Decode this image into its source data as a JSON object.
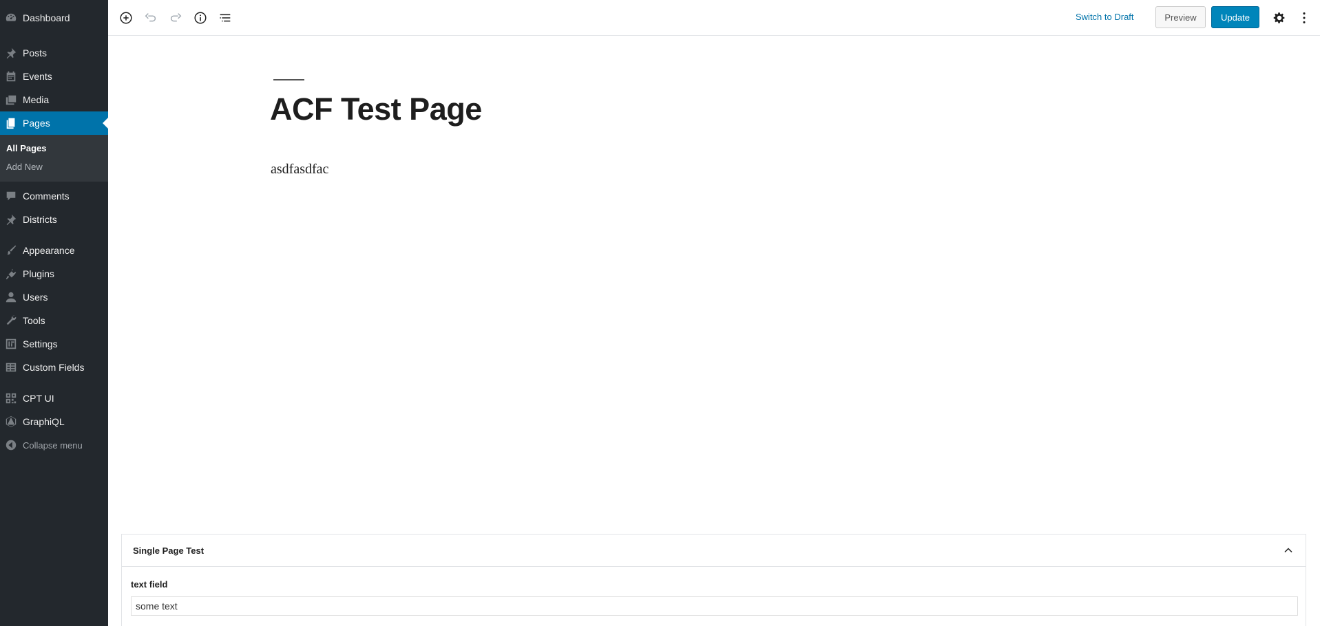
{
  "sidebar": {
    "items": [
      {
        "label": "Dashboard",
        "icon": "dashboard-icon"
      },
      {
        "label": "Posts",
        "icon": "pin-icon"
      },
      {
        "label": "Events",
        "icon": "calendar-icon"
      },
      {
        "label": "Media",
        "icon": "media-icon"
      },
      {
        "label": "Pages",
        "icon": "pages-icon"
      },
      {
        "label": "Comments",
        "icon": "comment-icon"
      },
      {
        "label": "Districts",
        "icon": "pin-icon"
      },
      {
        "label": "Appearance",
        "icon": "brush-icon"
      },
      {
        "label": "Plugins",
        "icon": "plugin-icon"
      },
      {
        "label": "Users",
        "icon": "user-icon"
      },
      {
        "label": "Tools",
        "icon": "wrench-icon"
      },
      {
        "label": "Settings",
        "icon": "settings-icon"
      },
      {
        "label": "Custom Fields",
        "icon": "table-icon"
      },
      {
        "label": "CPT UI",
        "icon": "grid-icon"
      },
      {
        "label": "GraphiQL",
        "icon": "graphql-icon"
      }
    ],
    "submenu": {
      "all_pages": "All Pages",
      "add_new": "Add New"
    },
    "collapse_label": "Collapse menu"
  },
  "toolbar": {
    "icons": [
      "add-block-icon",
      "undo-icon",
      "redo-icon",
      "info-icon",
      "outline-icon"
    ],
    "switch_draft_label": "Switch to Draft",
    "preview_label": "Preview",
    "update_label": "Update"
  },
  "editor": {
    "title": "ACF Test Page",
    "paragraph": "asdfasdfac"
  },
  "metabox": {
    "title": "Single Page Test",
    "field_label": "text field",
    "field_value": "some text"
  },
  "colors": {
    "sidebar_bg": "#23282d",
    "accent": "#0073aa",
    "update_button": "#0085ba"
  }
}
